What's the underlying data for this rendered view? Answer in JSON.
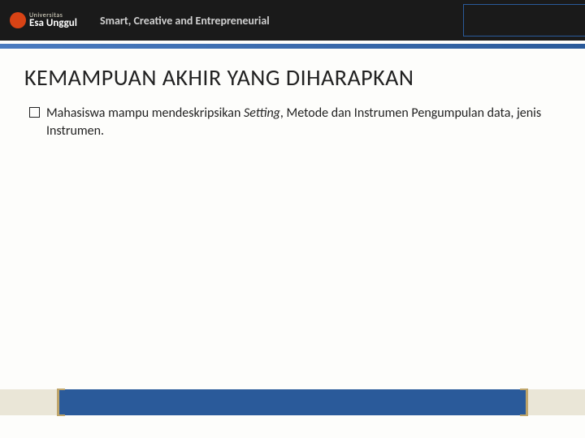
{
  "header": {
    "logo_top": "Universitas",
    "logo_main": "Esa Unggul",
    "tagline": "Smart, Creative and Entrepreneurial"
  },
  "slide": {
    "title": "KEMAMPUAN AKHIR YANG DIHARAPKAN",
    "bullet_pre": "Mahasiswa mampu mendeskripsikan ",
    "bullet_italic": "Setting",
    "bullet_post": ", Metode dan Instrumen Pengumpulan data, jenis Instrumen."
  }
}
